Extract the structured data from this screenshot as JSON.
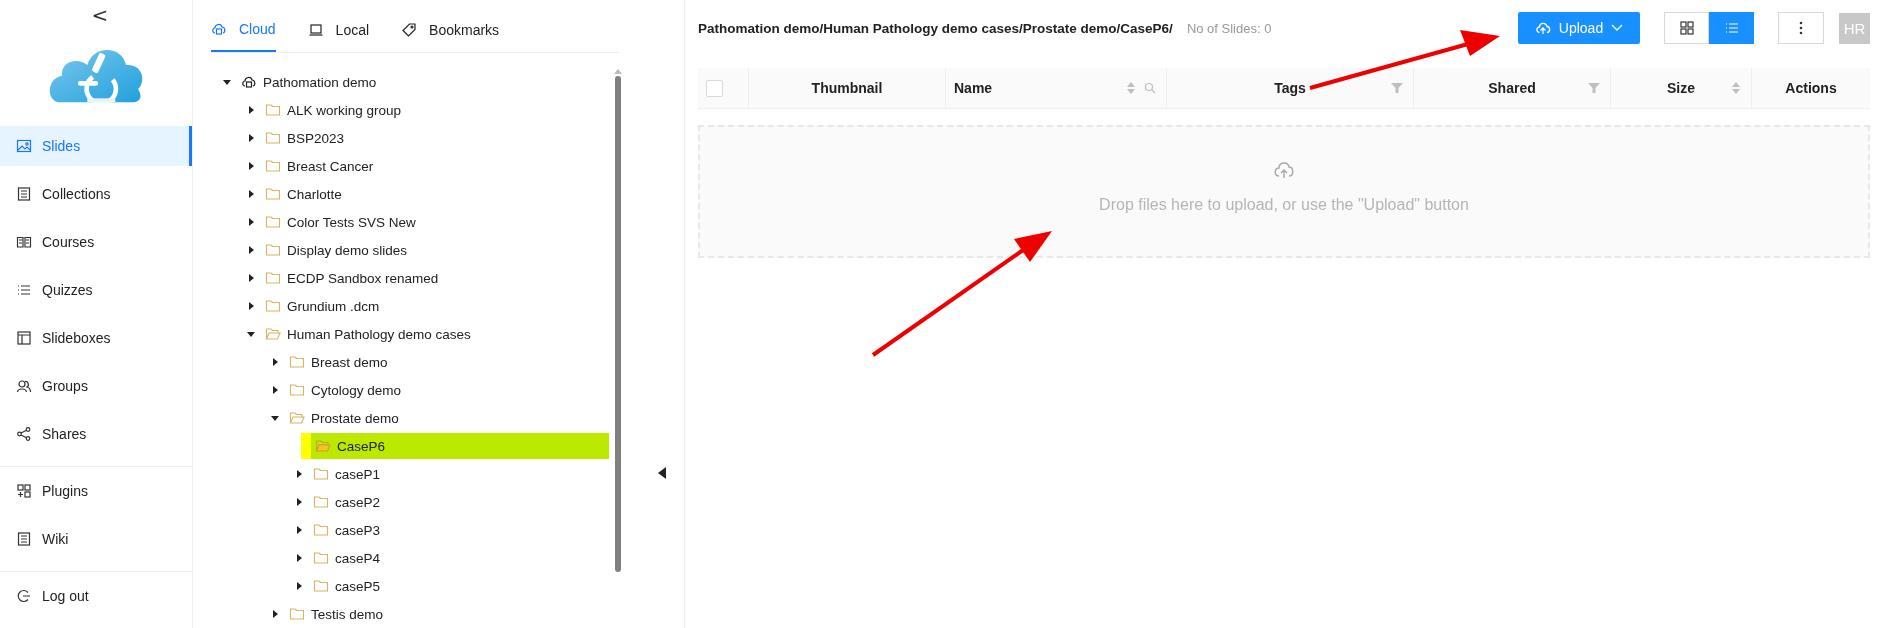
{
  "sidebar": {
    "collapse": "<",
    "sections": [
      {
        "items": [
          {
            "label": "Slides",
            "selected": true
          },
          {
            "label": "Collections",
            "selected": false
          },
          {
            "label": "Courses",
            "selected": false
          },
          {
            "label": "Quizzes",
            "selected": false
          },
          {
            "label": "Slideboxes",
            "selected": false
          },
          {
            "label": "Groups",
            "selected": false
          },
          {
            "label": "Shares",
            "selected": false
          }
        ]
      },
      {
        "items": [
          {
            "label": "Plugins",
            "selected": false
          },
          {
            "label": "Wiki",
            "selected": false
          }
        ]
      },
      {
        "items": [
          {
            "label": "Log out",
            "selected": false
          }
        ]
      }
    ]
  },
  "tree_panel": {
    "tabs": [
      {
        "label": "Cloud",
        "selected": true
      },
      {
        "label": "Local",
        "selected": false
      },
      {
        "label": "Bookmarks",
        "selected": false
      }
    ],
    "tree": [
      {
        "label": "Pathomation demo",
        "kind": "cloud",
        "expandable": true,
        "expanded": true,
        "selected": false,
        "children": [
          {
            "label": "ALK working group",
            "kind": "folder",
            "expandable": true,
            "expanded": false,
            "selected": false
          },
          {
            "label": "BSP2023",
            "kind": "folder",
            "expandable": true,
            "expanded": false,
            "selected": false
          },
          {
            "label": "Breast Cancer",
            "kind": "folder",
            "expandable": true,
            "expanded": false,
            "selected": false
          },
          {
            "label": "Charlotte",
            "kind": "folder",
            "expandable": true,
            "expanded": false,
            "selected": false
          },
          {
            "label": "Color Tests SVS New",
            "kind": "folder",
            "expandable": true,
            "expanded": false,
            "selected": false
          },
          {
            "label": "Display demo slides",
            "kind": "folder",
            "expandable": true,
            "expanded": false,
            "selected": false
          },
          {
            "label": "ECDP Sandbox renamed",
            "kind": "folder",
            "expandable": true,
            "expanded": false,
            "selected": false
          },
          {
            "label": "Grundium .dcm",
            "kind": "folder",
            "expandable": true,
            "expanded": false,
            "selected": false
          },
          {
            "label": "Human Pathology demo cases",
            "kind": "folder",
            "expandable": true,
            "expanded": true,
            "selected": false,
            "children": [
              {
                "label": "Breast demo",
                "kind": "folder",
                "expandable": true,
                "expanded": false,
                "selected": false
              },
              {
                "label": "Cytology demo",
                "kind": "folder",
                "expandable": true,
                "expanded": false,
                "selected": false
              },
              {
                "label": "Prostate demo",
                "kind": "folder",
                "expandable": true,
                "expanded": true,
                "selected": false,
                "children": [
                  {
                    "label": "CaseP6",
                    "kind": "folder",
                    "expandable": false,
                    "selected": true
                  },
                  {
                    "label": "caseP1",
                    "kind": "folder",
                    "expandable": true,
                    "expanded": false,
                    "selected": false
                  },
                  {
                    "label": "caseP2",
                    "kind": "folder",
                    "expandable": true,
                    "expanded": false,
                    "selected": false
                  },
                  {
                    "label": "caseP3",
                    "kind": "folder",
                    "expandable": true,
                    "expanded": false,
                    "selected": false
                  },
                  {
                    "label": "caseP4",
                    "kind": "folder",
                    "expandable": true,
                    "expanded": false,
                    "selected": false
                  },
                  {
                    "label": "caseP5",
                    "kind": "folder",
                    "expandable": true,
                    "expanded": false,
                    "selected": false
                  }
                ]
              },
              {
                "label": "Testis demo",
                "kind": "folder",
                "expandable": true,
                "expanded": false,
                "selected": false
              }
            ]
          }
        ]
      }
    ]
  },
  "main": {
    "breadcrumb": "Pathomation demo/Human Pathology demo cases/Prostate demo/CaseP6/",
    "slide_count": "No of Slides: 0",
    "upload_button": "Upload",
    "view_toggle": [
      {
        "kind": "grid",
        "selected": false
      },
      {
        "kind": "list",
        "selected": true
      }
    ],
    "avatar": "HR",
    "table": {
      "select_all_checked": false,
      "columns": [
        {
          "label": "Thumbnail",
          "sort": false,
          "search": false,
          "filter": false
        },
        {
          "label": "Name",
          "sort": true,
          "search": true,
          "filter": false
        },
        {
          "label": "Tags",
          "sort": false,
          "search": false,
          "filter": true
        },
        {
          "label": "Shared",
          "sort": false,
          "search": false,
          "filter": true
        },
        {
          "label": "Size",
          "sort": true,
          "search": false,
          "filter": false
        },
        {
          "label": "Actions",
          "sort": false,
          "search": false,
          "filter": false
        }
      ]
    },
    "dropzone": "Drop files here to upload, or use the \"Upload\" button"
  }
}
